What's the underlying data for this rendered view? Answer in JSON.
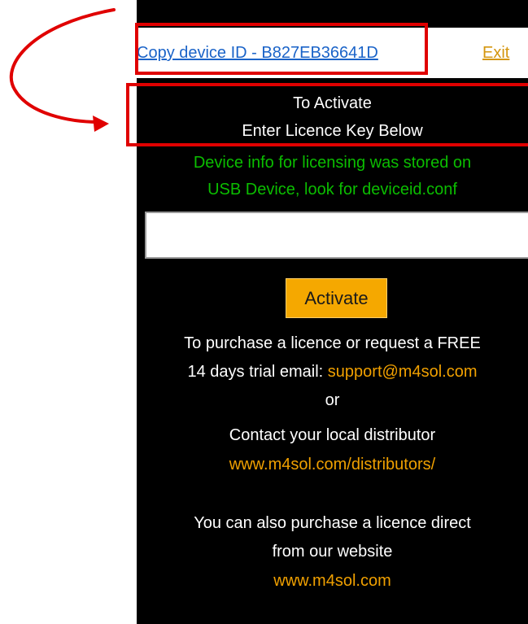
{
  "header": {
    "copy_device_id_label": "Copy device ID - B827EB36641D",
    "exit_label": "Exit"
  },
  "activation": {
    "title_line1": "To Activate",
    "title_line2": "Enter Licence Key Below",
    "info_line1": "Device info for licensing was stored on",
    "info_line2": "USB Device, look for deviceid.conf",
    "licence_input_value": "",
    "activate_button_label": "Activate"
  },
  "purchase": {
    "line1": "To purchase a licence or request a FREE",
    "line2_prefix": "14 days trial email:",
    "support_email": "support@m4sol.com",
    "or_label": "or",
    "contact_label": "Contact your local distributor",
    "distributors_url": "www.m4sol.com/distributors/",
    "direct_line1": "You can also purchase a licence direct",
    "direct_line2": "from our website",
    "website_url": "www.m4sol.com"
  },
  "colors": {
    "panel_bg": "#000000",
    "link_blue": "#1a63c8",
    "accent_orange": "#f0a000",
    "info_green": "#0bbd00",
    "annotation_red": "#e00000"
  }
}
